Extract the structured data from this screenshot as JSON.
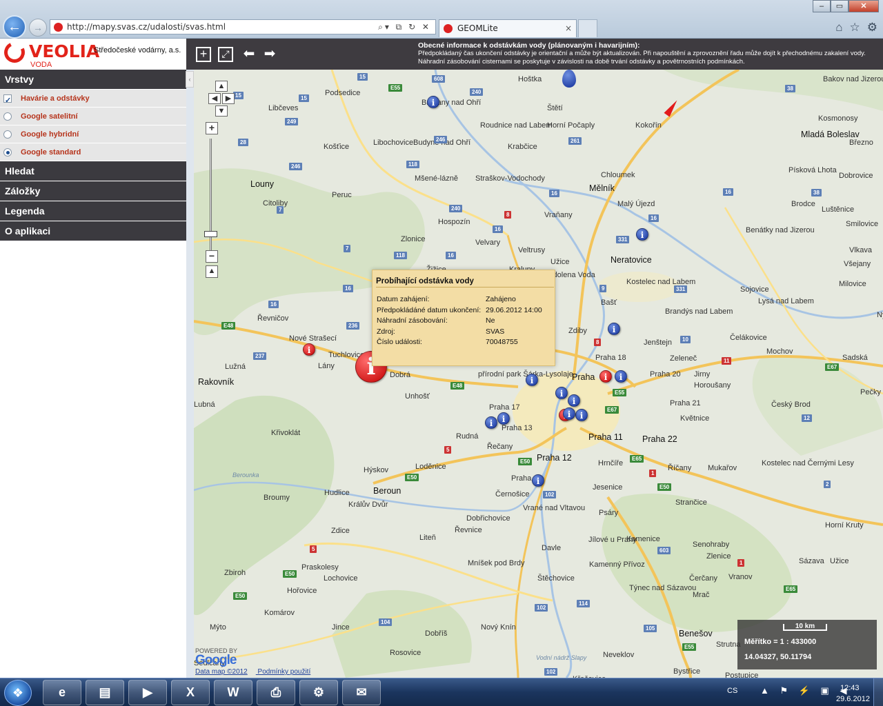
{
  "browser": {
    "url": "http://mapy.svas.cz/udalosti/svas.html",
    "tab_title": "GEOMLite",
    "tab_close": "×",
    "address_tools": "⌕▾ ⧉ ↻ ✕",
    "window_controls": [
      "–",
      "▭",
      "✕"
    ],
    "icons": [
      "home-icon",
      "star-icon",
      "gear-icon"
    ]
  },
  "header": {
    "logo_name": "VEOLIA",
    "logo_sub": "VODA",
    "company": "Středočeské vodárny, a.s.",
    "notice_title": "Obecné informace k odstávkám vody (plánovaným i havarijním):",
    "notice_text": "Předpokládaný čas ukončení odstávky je orientační a může být aktualizován. Při napouštění a zprovoznění řadu může dojít k přechodnému zakalení vody. Náhradní zásobování cisternami se poskytuje v závislosti na době trvání odstávky a povětrnostních podmínkách.",
    "toolbar": {
      "zoom_in": "+",
      "full_extent": "⤢",
      "back": "⬅",
      "forward": "➡"
    }
  },
  "sidebar": {
    "vrstvy": "Vrstvy",
    "layers": [
      {
        "label": "Havárie a odstávky",
        "type": "checkbox",
        "checked": true
      },
      {
        "label": "Google satelitní",
        "type": "radio",
        "checked": false
      },
      {
        "label": "Google hybridní",
        "type": "radio",
        "checked": false
      },
      {
        "label": "Google standard",
        "type": "radio",
        "checked": true
      }
    ],
    "hledat": "Hledat",
    "zalozky": "Záložky",
    "legenda": "Legenda",
    "o_aplikaci": "O aplikaci",
    "collapse": "‹"
  },
  "map": {
    "places": [
      [
        "Podsedice",
        190,
        28,
        0
      ],
      [
        "Libčeves",
        108,
        50,
        0
      ],
      [
        "Brozany nad Ohří",
        330,
        42,
        0
      ],
      [
        "Hoštka",
        470,
        8,
        0
      ],
      [
        "Roudnice nad Labem",
        415,
        75,
        0
      ],
      [
        "Štětí",
        512,
        50,
        0
      ],
      [
        "Horní Počaply",
        512,
        75,
        0
      ],
      [
        "Kokořín",
        640,
        75,
        0
      ],
      [
        "Mladá Boleslav",
        880,
        88,
        1
      ],
      [
        "Bakov nad Jizerou",
        912,
        8,
        0
      ],
      [
        "Kosmonosy",
        905,
        65,
        0
      ],
      [
        "Březno",
        950,
        100,
        0
      ],
      [
        "Košťice",
        188,
        106,
        0
      ],
      [
        "Libochovice",
        260,
        100,
        0
      ],
      [
        "Budyně nad Ohří",
        318,
        100,
        0
      ],
      [
        "Krabčice",
        455,
        106,
        0
      ],
      [
        "Chloumek",
        590,
        147,
        0
      ],
      [
        "Mělník",
        573,
        166,
        1
      ],
      [
        "Dobrovice",
        935,
        148,
        0
      ],
      [
        "Písková Lhota",
        862,
        140,
        0
      ],
      [
        "Louny",
        82,
        160,
        1
      ],
      [
        "Mšené-lázně",
        320,
        152,
        0
      ],
      [
        "Straškov-Vodochody",
        408,
        152,
        0
      ],
      [
        "Peruc",
        200,
        176,
        0
      ],
      [
        "Citoliby",
        100,
        188,
        0
      ],
      [
        "Malý Újezd",
        614,
        189,
        0
      ],
      [
        "Brodce",
        866,
        189,
        0
      ],
      [
        "Luštěnice",
        910,
        197,
        0
      ],
      [
        "Vraňany",
        508,
        205,
        0
      ],
      [
        "Hospozín",
        354,
        215,
        0
      ],
      [
        "Smilovice",
        945,
        218,
        0
      ],
      [
        "Benátky nad Jizerou",
        800,
        227,
        0
      ],
      [
        "Zlonice",
        300,
        240,
        0
      ],
      [
        "Velvary",
        408,
        245,
        0
      ],
      [
        "Veltrusy",
        470,
        256,
        0
      ],
      [
        "Neratovice",
        604,
        270,
        1
      ],
      [
        "Vlkava",
        950,
        256,
        0
      ],
      [
        "Všejany",
        942,
        276,
        0
      ],
      [
        "Užice",
        517,
        273,
        0
      ],
      [
        "Žižice",
        337,
        284,
        0
      ],
      [
        "Kralupy",
        457,
        284,
        0
      ],
      [
        "Odolena Voda",
        512,
        292,
        0
      ],
      [
        "Kostelec nad Labem",
        627,
        302,
        0
      ],
      [
        "Sojovice",
        792,
        313,
        0
      ],
      [
        "Milovice",
        935,
        305,
        0
      ],
      [
        "Lysá nad Labem",
        818,
        330,
        0
      ],
      [
        "Bašť",
        590,
        332,
        0
      ],
      [
        "Brandýs nad Labem",
        683,
        345,
        0
      ],
      [
        "Nymbu",
        990,
        350,
        0
      ],
      [
        "Řevničov",
        92,
        355,
        0
      ],
      [
        "Zdiby",
        543,
        373,
        0
      ],
      [
        "Čelákovice",
        777,
        383,
        0
      ],
      [
        "Jenštejn",
        652,
        390,
        0
      ],
      [
        "Nové Strašecí",
        138,
        384,
        0
      ],
      [
        "Tuchlovice",
        195,
        408,
        0
      ],
      [
        "Mochov",
        830,
        403,
        0
      ],
      [
        "Praha 18",
        582,
        412,
        0
      ],
      [
        "Zeleneč",
        690,
        413,
        0
      ],
      [
        "Sadská",
        940,
        412,
        0
      ],
      [
        "Lužná",
        45,
        425,
        0
      ],
      [
        "Lány",
        180,
        424,
        0
      ],
      [
        "Dobrá",
        284,
        437,
        0
      ],
      [
        "přírodní park Šárka-Lysolaje",
        412,
        436,
        0
      ],
      [
        "Praha 20",
        661,
        436,
        0
      ],
      [
        "Jirny",
        725,
        436,
        0
      ],
      [
        "Praha",
        548,
        440,
        1
      ],
      [
        "Rakovník",
        6,
        447,
        1
      ],
      [
        "Horoušany",
        725,
        452,
        0
      ],
      [
        "Pečky",
        966,
        462,
        0
      ],
      [
        "Unhošť",
        306,
        468,
        0
      ],
      [
        "Praha 21",
        690,
        478,
        0
      ],
      [
        "Český Brod",
        837,
        480,
        0
      ],
      [
        "Praha 17",
        428,
        484,
        0
      ],
      [
        "Lubná",
        0,
        480,
        0
      ],
      [
        "Praha 13",
        446,
        514,
        0
      ],
      [
        "Křivoklát",
        112,
        521,
        0
      ],
      [
        "Květnice",
        705,
        500,
        0
      ],
      [
        "Rudná",
        380,
        526,
        0
      ],
      [
        "Praha 11",
        572,
        527,
        1
      ],
      [
        "Praha 22",
        650,
        530,
        1
      ],
      [
        "Řečany",
        425,
        541,
        0
      ],
      [
        "Praha 12",
        497,
        557,
        1
      ],
      [
        "Hrnčíře",
        586,
        565,
        0
      ],
      [
        "Říčany",
        687,
        572,
        0
      ],
      [
        "Kostelec nad Černými Lesy",
        823,
        565,
        0
      ],
      [
        "Mukařov",
        745,
        572,
        0
      ],
      [
        "Hýskov",
        246,
        575,
        0
      ],
      [
        "Loděnice",
        321,
        570,
        0
      ],
      [
        "Praha",
        460,
        587,
        0
      ],
      [
        "Jesenice",
        578,
        600,
        0
      ],
      [
        "Beroun",
        260,
        605,
        1
      ],
      [
        "Hudlice",
        189,
        608,
        0
      ],
      [
        "Černošice",
        437,
        610,
        0
      ],
      [
        "Králův Dvůr",
        224,
        625,
        0
      ],
      [
        "Broumy",
        101,
        615,
        0
      ],
      [
        "Strančice",
        698,
        622,
        0
      ],
      [
        "Vrané nad Vltavou",
        477,
        630,
        0
      ],
      [
        "Psáry",
        587,
        637,
        0
      ],
      [
        "Dobřichovice",
        395,
        645,
        0
      ],
      [
        "Řevnice",
        378,
        662,
        0
      ],
      [
        "Zdice",
        199,
        663,
        0
      ],
      [
        "Horní Kruty",
        915,
        655,
        0
      ],
      [
        "Liteň",
        327,
        673,
        0
      ],
      [
        "Jílové u Prahy",
        572,
        676,
        0
      ],
      [
        "Kamenice",
        627,
        675,
        0
      ],
      [
        "Senohraby",
        723,
        683,
        0
      ],
      [
        "Davle",
        504,
        688,
        0
      ],
      [
        "Zlenice",
        743,
        700,
        0
      ],
      [
        "Mníšek pod Brdy",
        397,
        710,
        0
      ],
      [
        "Kamenný Přívoz",
        573,
        712,
        0
      ],
      [
        "Sázava",
        877,
        707,
        0
      ],
      [
        "Užice",
        922,
        707,
        0
      ],
      [
        "Praskolesy",
        156,
        716,
        0
      ],
      [
        "Zbiroh",
        44,
        724,
        0
      ],
      [
        "Lochovice",
        188,
        732,
        0
      ],
      [
        "Štěchovice",
        498,
        732,
        0
      ],
      [
        "Čerčany",
        718,
        732,
        0
      ],
      [
        "Vranov",
        775,
        730,
        0
      ],
      [
        "Hořovice",
        135,
        750,
        0
      ],
      [
        "Týnec nad Sázavou",
        631,
        746,
        0
      ],
      [
        "Mrač",
        723,
        756,
        0
      ],
      [
        "Komárov",
        102,
        782,
        0
      ],
      [
        "Mýto",
        23,
        803,
        0
      ],
      [
        "Jince",
        200,
        803,
        0
      ],
      [
        "Nový Knín",
        416,
        803,
        0
      ],
      [
        "Dobříš",
        335,
        812,
        0
      ],
      [
        "Benešov",
        703,
        812,
        1
      ],
      [
        "Rosovice",
        284,
        840,
        0
      ],
      [
        "Neveklov",
        593,
        843,
        0
      ],
      [
        "Strutna",
        757,
        828,
        0
      ],
      [
        "Bystřice",
        695,
        867,
        0
      ],
      [
        "Postupice",
        770,
        873,
        0
      ],
      [
        "Křečovice",
        549,
        878,
        0
      ],
      [
        "Sedlčany",
        0,
        855,
        0
      ]
    ],
    "water": [
      [
        "Berounka",
        56,
        582
      ],
      [
        "Vodní nádrž Slapy",
        496,
        847
      ]
    ],
    "shields": [
      [
        "608",
        345,
        8,
        "b"
      ],
      [
        "15",
        237,
        5,
        "b"
      ],
      [
        "15",
        57,
        32,
        "b"
      ],
      [
        "15",
        152,
        36,
        "b"
      ],
      [
        "240",
        400,
        27,
        "b"
      ],
      [
        "E55",
        282,
        21,
        "g"
      ],
      [
        "249",
        132,
        70,
        "b"
      ],
      [
        "246",
        348,
        96,
        "b"
      ],
      [
        "261",
        543,
        98,
        "b"
      ],
      [
        "28",
        64,
        100,
        "b"
      ],
      [
        "246",
        138,
        135,
        "b"
      ],
      [
        "118",
        308,
        132,
        "b"
      ],
      [
        "38",
        857,
        22,
        "b"
      ],
      [
        "38",
        895,
        173,
        "b"
      ],
      [
        "16",
        515,
        174,
        "b"
      ],
      [
        "16",
        767,
        172,
        "b"
      ],
      [
        "240",
        370,
        196,
        "b"
      ],
      [
        "8",
        450,
        205,
        "r"
      ],
      [
        "7",
        120,
        198,
        "b"
      ],
      [
        "16",
        659,
        210,
        "b"
      ],
      [
        "16",
        433,
        226,
        "b"
      ],
      [
        "331",
        612,
        241,
        "b"
      ],
      [
        "7",
        217,
        254,
        "b"
      ],
      [
        "118",
        290,
        264,
        "b"
      ],
      [
        "16",
        365,
        264,
        "b"
      ],
      [
        "9",
        588,
        312,
        "b"
      ],
      [
        "16",
        216,
        312,
        "b"
      ],
      [
        "16",
        108,
        335,
        "b"
      ],
      [
        "331",
        696,
        313,
        "b"
      ],
      [
        "E48",
        40,
        366,
        "g"
      ],
      [
        "236",
        221,
        366,
        "b"
      ],
      [
        "237",
        86,
        410,
        "b"
      ],
      [
        "8",
        580,
        390,
        "r"
      ],
      [
        "10",
        705,
        386,
        "b"
      ],
      [
        "11",
        765,
        417,
        "r"
      ],
      [
        "E67",
        915,
        426,
        "g"
      ],
      [
        "E48",
        372,
        453,
        "g"
      ],
      [
        "E55",
        607,
        463,
        "g"
      ],
      [
        "E67",
        596,
        488,
        "g"
      ],
      [
        "12",
        881,
        500,
        "b"
      ],
      [
        "5",
        363,
        546,
        "r"
      ],
      [
        "E50",
        470,
        563,
        "g"
      ],
      [
        "E65",
        632,
        559,
        "g"
      ],
      [
        "1",
        660,
        580,
        "r"
      ],
      [
        "E50",
        306,
        586,
        "g"
      ],
      [
        "E50",
        672,
        600,
        "g"
      ],
      [
        "2",
        913,
        596,
        "b"
      ],
      [
        "102",
        506,
        611,
        "b"
      ],
      [
        "603",
        672,
        692,
        "b"
      ],
      [
        "5",
        168,
        690,
        "r"
      ],
      [
        "E50",
        129,
        726,
        "g"
      ],
      [
        "E50",
        57,
        758,
        "g"
      ],
      [
        "1",
        788,
        710,
        "r"
      ],
      [
        "E65",
        855,
        748,
        "g"
      ],
      [
        "102",
        494,
        775,
        "b"
      ],
      [
        "114",
        555,
        769,
        "b"
      ],
      [
        "105",
        652,
        805,
        "b"
      ],
      [
        "E55",
        708,
        832,
        "g"
      ],
      [
        "104",
        268,
        796,
        "b"
      ],
      [
        "102",
        508,
        868,
        "b"
      ]
    ],
    "markers": [
      [
        "blue",
        338,
        38
      ],
      [
        "blue",
        641,
        230
      ],
      [
        "red",
        158,
        397
      ],
      [
        "blue",
        600,
        367
      ],
      [
        "blue",
        481,
        441
      ],
      [
        "red",
        588,
        436
      ],
      [
        "blue",
        610,
        436
      ],
      [
        "blue",
        524,
        460
      ],
      [
        "blue",
        542,
        471
      ],
      [
        "red",
        529,
        492
      ],
      [
        "blue",
        553,
        492
      ],
      [
        "blue",
        422,
        503
      ],
      [
        "blue",
        440,
        497
      ],
      [
        "blue",
        490,
        587
      ],
      [
        "blue",
        535,
        490
      ]
    ],
    "big_marker": "i",
    "popup": {
      "title": "Probíhající odstávka vody",
      "rows": [
        {
          "k": "Datum zahájení:",
          "v": "Zahájeno"
        },
        {
          "k": "Předpokládáné datum ukončení:",
          "v": "29.06.2012 14:00"
        },
        {
          "k": "Náhradní zásobování:",
          "v": "Ne"
        },
        {
          "k": "Zdroj:",
          "v": "SVAS"
        },
        {
          "k": "Číslo události:",
          "v": "70048755"
        }
      ]
    },
    "scale_bar": "10 km",
    "scale_text": "Měřítko = 1 : 433000",
    "coords": "14.04327, 50.11794",
    "powered_by": "POWERED BY",
    "google": "Google",
    "data_link": "Data map ©2012",
    "terms_link": "Podmínky použití",
    "marker_glyph": "i"
  },
  "taskbar": {
    "items": [
      "e",
      "▤",
      "▶",
      "X",
      "W",
      "⎙",
      "⚙",
      "✉"
    ],
    "lang": "CS",
    "tray": "▲ ⚑ ⚡ ▣ ◀",
    "time": "12:43",
    "date": "29.6.2012"
  }
}
